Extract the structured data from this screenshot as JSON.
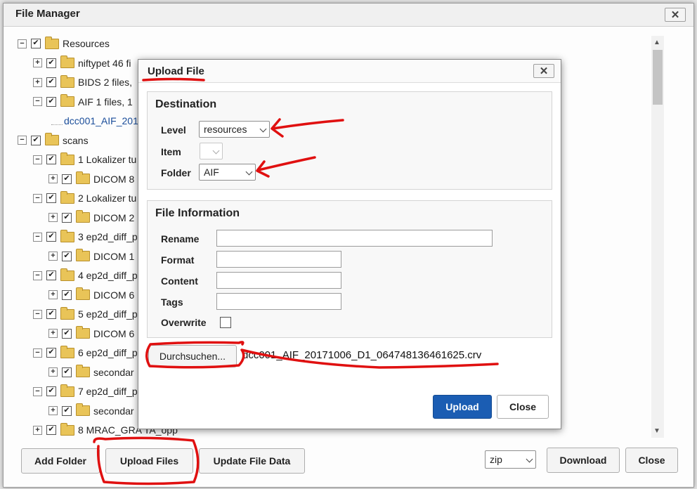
{
  "file_manager": {
    "title": "File Manager",
    "close_glyph": "✕",
    "tree": [
      {
        "indent": 0,
        "expander": "−",
        "checked": true,
        "label": "Resources"
      },
      {
        "indent": 1,
        "expander": "+",
        "checked": true,
        "label": "niftypet  46 fi"
      },
      {
        "indent": 1,
        "expander": "+",
        "checked": true,
        "label": "BIDS  2 files,"
      },
      {
        "indent": 1,
        "expander": "−",
        "checked": true,
        "label": "AIF  1 files, 1"
      },
      {
        "indent": 2,
        "expander": "",
        "checked": false,
        "label": "dcc001_AIF_201",
        "is_file": true
      },
      {
        "indent": 0,
        "expander": "−",
        "checked": true,
        "label": "scans"
      },
      {
        "indent": 1,
        "expander": "−",
        "checked": true,
        "label": "1 Lokalizer tu"
      },
      {
        "indent": 2,
        "expander": "+",
        "checked": true,
        "label": "DICOM  8"
      },
      {
        "indent": 1,
        "expander": "−",
        "checked": true,
        "label": "2 Lokalizer tu"
      },
      {
        "indent": 2,
        "expander": "+",
        "checked": true,
        "label": "DICOM  2"
      },
      {
        "indent": 1,
        "expander": "−",
        "checked": true,
        "label": "3 ep2d_diff_p"
      },
      {
        "indent": 2,
        "expander": "+",
        "checked": true,
        "label": "DICOM  1"
      },
      {
        "indent": 1,
        "expander": "−",
        "checked": true,
        "label": "4 ep2d_diff_p"
      },
      {
        "indent": 2,
        "expander": "+",
        "checked": true,
        "label": "DICOM  6"
      },
      {
        "indent": 1,
        "expander": "−",
        "checked": true,
        "label": "5 ep2d_diff_p"
      },
      {
        "indent": 2,
        "expander": "+",
        "checked": true,
        "label": "DICOM  6"
      },
      {
        "indent": 1,
        "expander": "−",
        "checked": true,
        "label": "6 ep2d_diff_p"
      },
      {
        "indent": 2,
        "expander": "+",
        "checked": true,
        "label": "secondar"
      },
      {
        "indent": 1,
        "expander": "−",
        "checked": true,
        "label": "7 ep2d_diff_p"
      },
      {
        "indent": 2,
        "expander": "+",
        "checked": true,
        "label": "secondar"
      },
      {
        "indent": 1,
        "expander": "+",
        "checked": true,
        "label": "8 MRAC_GRA   TA_opp"
      }
    ],
    "buttons": {
      "add_folder": "Add Folder",
      "upload_files": "Upload Files",
      "update_file_data": "Update File Data",
      "download": "Download",
      "close": "Close"
    },
    "format_select": "zip"
  },
  "upload_dialog": {
    "title": "Upload File",
    "close_glyph": "✕",
    "destination": {
      "legend": "Destination",
      "level_label": "Level",
      "level_value": "resources",
      "item_label": "Item",
      "item_value": "",
      "folder_label": "Folder",
      "folder_value": "AIF"
    },
    "file_information": {
      "legend": "File Information",
      "rename_label": "Rename",
      "format_label": "Format",
      "content_label": "Content",
      "tags_label": "Tags",
      "overwrite_label": "Overwrite"
    },
    "browse_button": "Durchsuchen...",
    "selected_file": "dcc001_AIF_20171006_D1_064748136461625.crv",
    "upload_button": "Upload",
    "close_button": "Close"
  },
  "colors": {
    "primary_button": "#1b5db3",
    "annotation_red": "#e01010"
  }
}
